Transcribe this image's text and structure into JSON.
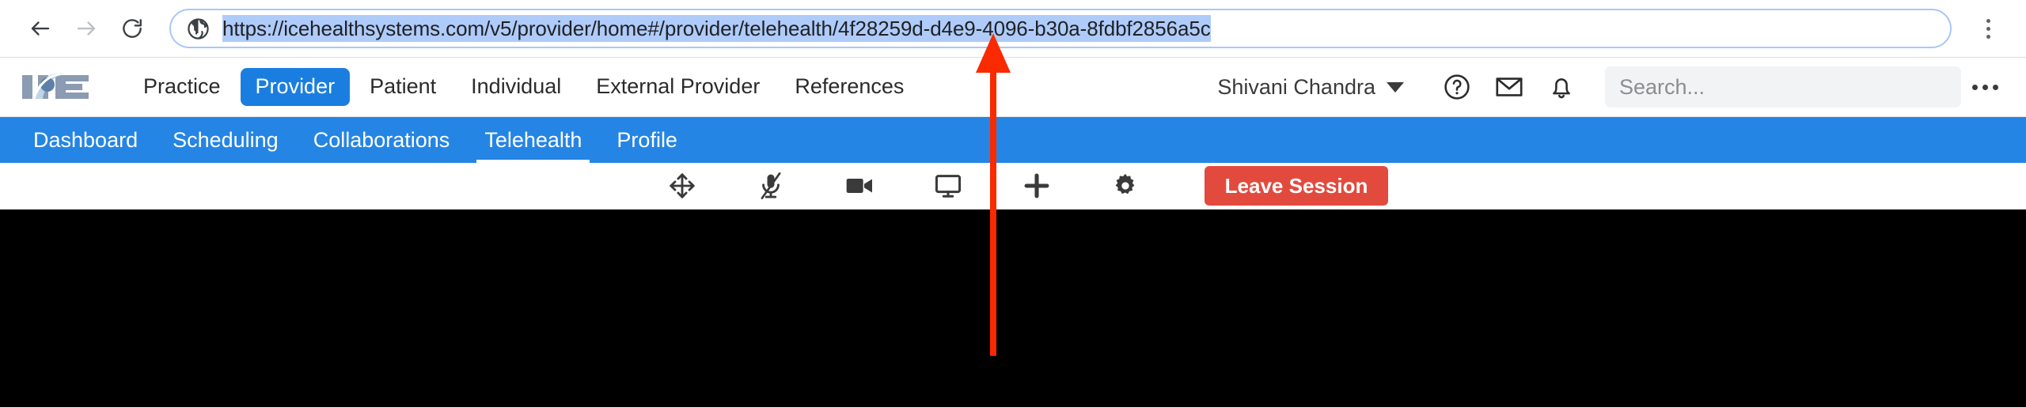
{
  "browser": {
    "back_label": "Back",
    "forward_label": "Forward",
    "reload_label": "Reload",
    "url": "https://icehealthsystems.com/v5/provider/home#/provider/telehealth/4f28259d-d4e9-4096-b30a-8fdbf2856a5c",
    "url_selected": true,
    "menu_label": "Customize and control"
  },
  "app": {
    "logo_text": "ICE",
    "main_nav": [
      {
        "label": "Practice",
        "active": false
      },
      {
        "label": "Provider",
        "active": true
      },
      {
        "label": "Patient",
        "active": false
      },
      {
        "label": "Individual",
        "active": false
      },
      {
        "label": "External Provider",
        "active": false
      },
      {
        "label": "References",
        "active": false
      }
    ],
    "user": {
      "name": "Shivani Chandra"
    },
    "header_icons": [
      {
        "name": "help-icon",
        "label": "Help"
      },
      {
        "name": "mail-icon",
        "label": "Messages"
      },
      {
        "name": "bell-icon",
        "label": "Notifications"
      }
    ],
    "search": {
      "placeholder": "Search...",
      "value": ""
    },
    "subnav": [
      {
        "label": "Dashboard",
        "active": false
      },
      {
        "label": "Scheduling",
        "active": false
      },
      {
        "label": "Collaborations",
        "active": false
      },
      {
        "label": "Telehealth",
        "active": true
      },
      {
        "label": "Profile",
        "active": false
      }
    ]
  },
  "telehealth": {
    "toolbar": [
      {
        "name": "move-icon",
        "label": "Move"
      },
      {
        "name": "microphone-muted-icon",
        "label": "Microphone muted"
      },
      {
        "name": "video-camera-icon",
        "label": "Camera"
      },
      {
        "name": "screen-share-icon",
        "label": "Share screen"
      },
      {
        "name": "plus-icon",
        "label": "Add participant"
      },
      {
        "name": "gear-icon",
        "label": "Settings"
      }
    ],
    "leave_label": "Leave Session"
  },
  "colors": {
    "accent_blue": "#2585e4",
    "nav_active_blue": "#1a7ee0",
    "leave_red": "#e24a3e",
    "url_highlight": "#aecbfa",
    "annotation_red": "#fa2a00",
    "video_background": "#000000"
  }
}
